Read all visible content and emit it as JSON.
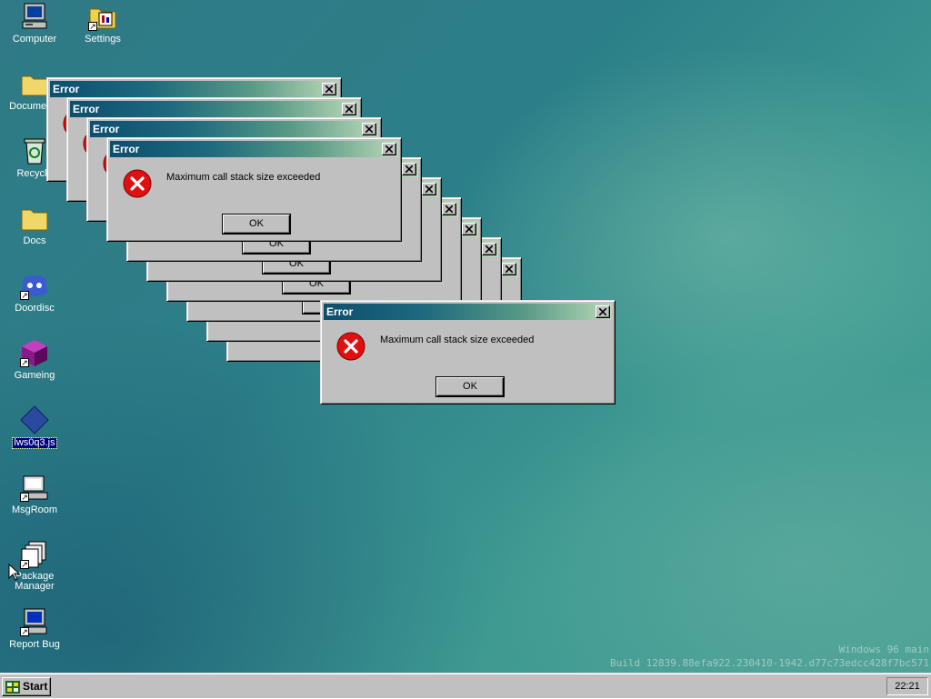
{
  "desktop": {
    "icons": [
      {
        "label": "Computer",
        "icon": "computer-icon"
      },
      {
        "label": "Settings",
        "icon": "settings-folder-icon"
      },
      {
        "label": "Documents",
        "icon": "documents-folder-icon"
      },
      {
        "label": "Recycle",
        "icon": "recycle-bin-icon"
      },
      {
        "label": "Docs",
        "icon": "folder-icon"
      },
      {
        "label": "Doordisc",
        "icon": "doordisc-icon"
      },
      {
        "label": "Gameing",
        "icon": "game-cube-icon"
      },
      {
        "label": "lws0q3.js",
        "icon": "js-file-icon"
      },
      {
        "label": "MsgRoom",
        "icon": "msgroom-icon"
      },
      {
        "label": "Package\nManager",
        "icon": "package-manager-icon"
      },
      {
        "label": "Report Bug",
        "icon": "report-bug-icon"
      }
    ]
  },
  "dialog": {
    "title": "Error",
    "message": "Maximum call stack size exceeded",
    "ok_label": "OK"
  },
  "watermark": {
    "line1": "Windows 96 main",
    "line2": "Build 12839.88efa922.230410-1942.d77c73edcc428f7bc571"
  },
  "taskbar": {
    "start_label": "Start",
    "clock": "22:21"
  },
  "colors": {
    "title_active_start": "#0c4e6e",
    "title_active_end": "#b8d8b8",
    "error_red": "#e01010",
    "window_face": "#c0c0c0"
  }
}
